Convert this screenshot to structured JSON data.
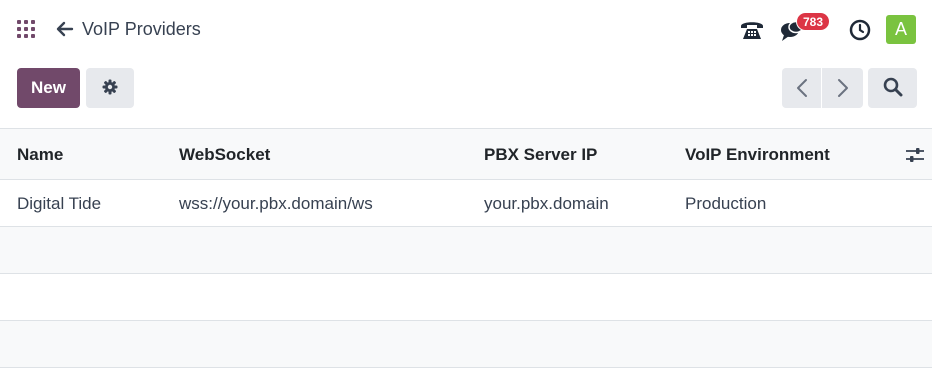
{
  "header": {
    "breadcrumb_title": "VoIP Providers",
    "messages_badge": "783",
    "avatar_initial": "A"
  },
  "toolbar": {
    "new_label": "New"
  },
  "table": {
    "columns": [
      "Name",
      "WebSocket",
      "PBX Server IP",
      "VoIP Environment"
    ],
    "rows": [
      [
        "Digital Tide",
        "wss://your.pbx.domain/ws",
        "your.pbx.domain",
        "Production"
      ]
    ]
  },
  "colors": {
    "primary": "#71496a",
    "badge": "#dc3545",
    "avatar": "#7ac33f"
  },
  "icons": [
    "apps-grid-icon",
    "back-arrow-icon",
    "phone-icon",
    "chat-icon",
    "clock-icon",
    "gear-icon",
    "chevron-left-icon",
    "chevron-right-icon",
    "search-icon",
    "column-settings-icon"
  ]
}
